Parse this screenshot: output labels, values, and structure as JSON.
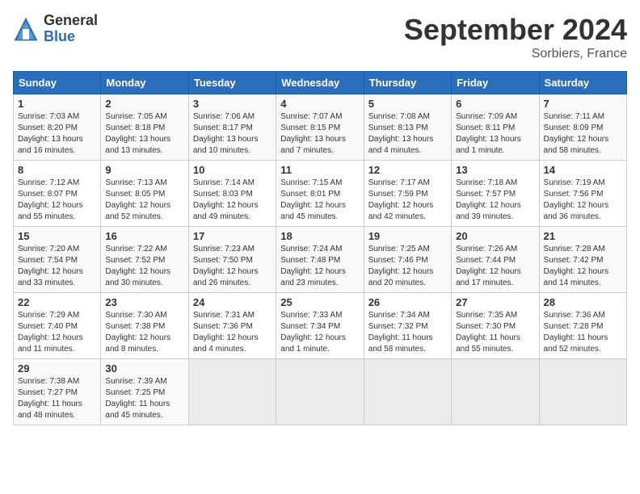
{
  "logo": {
    "general": "General",
    "blue": "Blue"
  },
  "title": "September 2024",
  "location": "Sorbiers, France",
  "days_of_week": [
    "Sunday",
    "Monday",
    "Tuesday",
    "Wednesday",
    "Thursday",
    "Friday",
    "Saturday"
  ],
  "weeks": [
    [
      {
        "num": "1",
        "rise": "7:03 AM",
        "set": "8:20 PM",
        "daylight": "13 hours and 16 minutes."
      },
      {
        "num": "2",
        "rise": "7:05 AM",
        "set": "8:18 PM",
        "daylight": "13 hours and 13 minutes."
      },
      {
        "num": "3",
        "rise": "7:06 AM",
        "set": "8:17 PM",
        "daylight": "13 hours and 10 minutes."
      },
      {
        "num": "4",
        "rise": "7:07 AM",
        "set": "8:15 PM",
        "daylight": "13 hours and 7 minutes."
      },
      {
        "num": "5",
        "rise": "7:08 AM",
        "set": "8:13 PM",
        "daylight": "13 hours and 4 minutes."
      },
      {
        "num": "6",
        "rise": "7:09 AM",
        "set": "8:11 PM",
        "daylight": "13 hours and 1 minute."
      },
      {
        "num": "7",
        "rise": "7:11 AM",
        "set": "8:09 PM",
        "daylight": "12 hours and 58 minutes."
      }
    ],
    [
      {
        "num": "8",
        "rise": "7:12 AM",
        "set": "8:07 PM",
        "daylight": "12 hours and 55 minutes."
      },
      {
        "num": "9",
        "rise": "7:13 AM",
        "set": "8:05 PM",
        "daylight": "12 hours and 52 minutes."
      },
      {
        "num": "10",
        "rise": "7:14 AM",
        "set": "8:03 PM",
        "daylight": "12 hours and 49 minutes."
      },
      {
        "num": "11",
        "rise": "7:15 AM",
        "set": "8:01 PM",
        "daylight": "12 hours and 45 minutes."
      },
      {
        "num": "12",
        "rise": "7:17 AM",
        "set": "7:59 PM",
        "daylight": "12 hours and 42 minutes."
      },
      {
        "num": "13",
        "rise": "7:18 AM",
        "set": "7:57 PM",
        "daylight": "12 hours and 39 minutes."
      },
      {
        "num": "14",
        "rise": "7:19 AM",
        "set": "7:56 PM",
        "daylight": "12 hours and 36 minutes."
      }
    ],
    [
      {
        "num": "15",
        "rise": "7:20 AM",
        "set": "7:54 PM",
        "daylight": "12 hours and 33 minutes."
      },
      {
        "num": "16",
        "rise": "7:22 AM",
        "set": "7:52 PM",
        "daylight": "12 hours and 30 minutes."
      },
      {
        "num": "17",
        "rise": "7:23 AM",
        "set": "7:50 PM",
        "daylight": "12 hours and 26 minutes."
      },
      {
        "num": "18",
        "rise": "7:24 AM",
        "set": "7:48 PM",
        "daylight": "12 hours and 23 minutes."
      },
      {
        "num": "19",
        "rise": "7:25 AM",
        "set": "7:46 PM",
        "daylight": "12 hours and 20 minutes."
      },
      {
        "num": "20",
        "rise": "7:26 AM",
        "set": "7:44 PM",
        "daylight": "12 hours and 17 minutes."
      },
      {
        "num": "21",
        "rise": "7:28 AM",
        "set": "7:42 PM",
        "daylight": "12 hours and 14 minutes."
      }
    ],
    [
      {
        "num": "22",
        "rise": "7:29 AM",
        "set": "7:40 PM",
        "daylight": "12 hours and 11 minutes."
      },
      {
        "num": "23",
        "rise": "7:30 AM",
        "set": "7:38 PM",
        "daylight": "12 hours and 8 minutes."
      },
      {
        "num": "24",
        "rise": "7:31 AM",
        "set": "7:36 PM",
        "daylight": "12 hours and 4 minutes."
      },
      {
        "num": "25",
        "rise": "7:33 AM",
        "set": "7:34 PM",
        "daylight": "12 hours and 1 minute."
      },
      {
        "num": "26",
        "rise": "7:34 AM",
        "set": "7:32 PM",
        "daylight": "11 hours and 58 minutes."
      },
      {
        "num": "27",
        "rise": "7:35 AM",
        "set": "7:30 PM",
        "daylight": "11 hours and 55 minutes."
      },
      {
        "num": "28",
        "rise": "7:36 AM",
        "set": "7:28 PM",
        "daylight": "11 hours and 52 minutes."
      }
    ],
    [
      {
        "num": "29",
        "rise": "7:38 AM",
        "set": "7:27 PM",
        "daylight": "11 hours and 48 minutes."
      },
      {
        "num": "30",
        "rise": "7:39 AM",
        "set": "7:25 PM",
        "daylight": "11 hours and 45 minutes."
      },
      null,
      null,
      null,
      null,
      null
    ]
  ]
}
